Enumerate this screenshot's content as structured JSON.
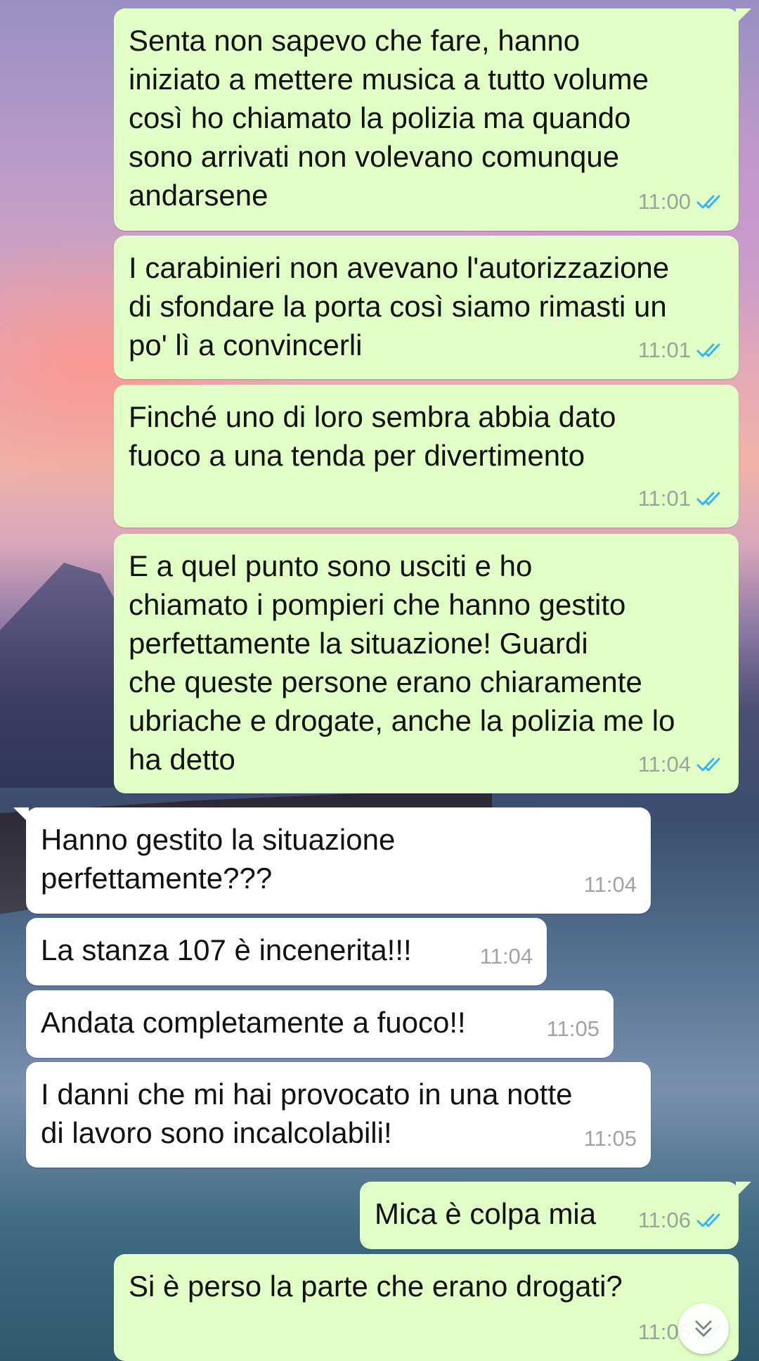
{
  "colors": {
    "outgoing_bubble": "#e1fec6",
    "incoming_bubble": "#ffffff",
    "read_ticks": "#34b7f1",
    "timestamp": "#9aa39a"
  },
  "messages": [
    {
      "direction": "outgoing",
      "text": "Senta non sapevo che fare, hanno\niniziato a mettere musica a tutto volume\ncosì ho chiamato la polizia ma quando\nsono arrivati non volevano comunque\nandarsene",
      "time": "11:00",
      "status": "read"
    },
    {
      "direction": "outgoing",
      "text": "I carabinieri non avevano l'autorizzazione\ndi sfondare la porta così siamo rimasti un\npo' lì a convincerli",
      "time": "11:01",
      "status": "read"
    },
    {
      "direction": "outgoing",
      "text": "Finché uno di loro sembra abbia dato\nfuoco a una tenda per divertimento",
      "time": "11:01",
      "status": "read"
    },
    {
      "direction": "outgoing",
      "text": "E a quel punto sono usciti e ho\nchiamato i pompieri che hanno gestito\nperfettamente la situazione! Guardi\nche queste persone erano chiaramente\nubriache e drogate, anche la polizia me lo\nha detto",
      "time": "11:04",
      "status": "read"
    },
    {
      "direction": "incoming",
      "text": "Hanno gestito la situazione\nperfettamente???",
      "time": "11:04"
    },
    {
      "direction": "incoming",
      "text": "La stanza 107 è incenerita!!!",
      "time": "11:04"
    },
    {
      "direction": "incoming",
      "text": "Andata completamente a fuoco!!",
      "time": "11:05"
    },
    {
      "direction": "incoming",
      "text": "I danni che mi hai provocato in una notte\ndi lavoro sono incalcolabili!",
      "time": "11:05"
    },
    {
      "direction": "outgoing",
      "text": "Mica è colpa mia",
      "time": "11:06",
      "status": "read"
    },
    {
      "direction": "outgoing",
      "text": "Si è perso la parte che erano drogati?",
      "time": "11:06",
      "status": "read"
    }
  ],
  "scroll_button": {
    "icon": "double-chevron-down-icon"
  }
}
